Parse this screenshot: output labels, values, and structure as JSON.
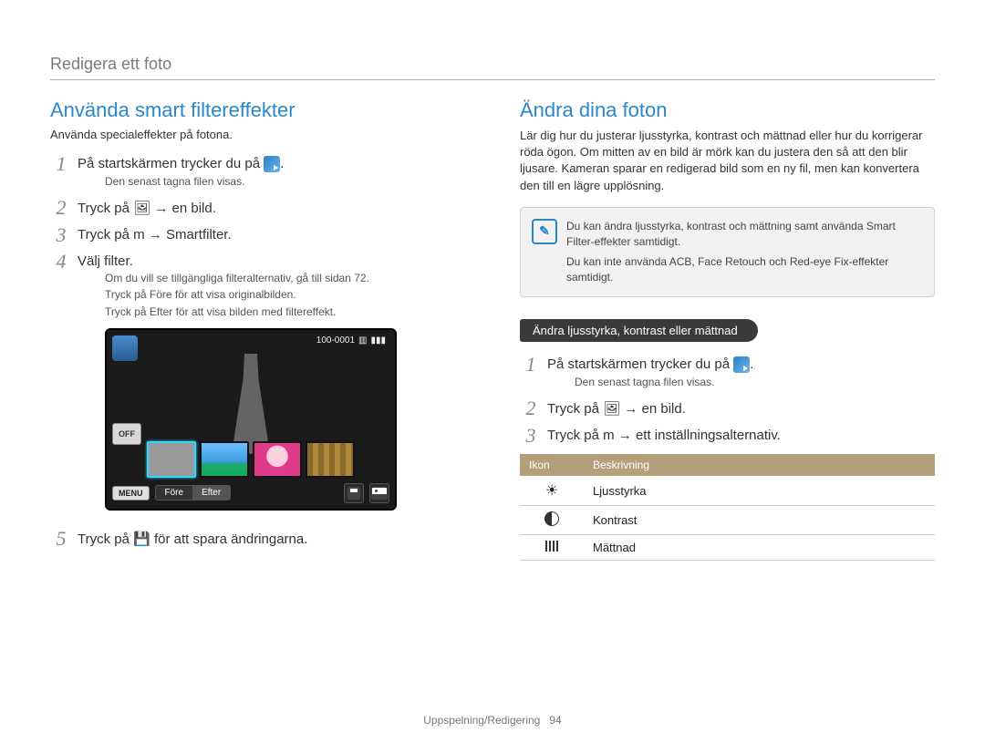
{
  "header": {
    "title": "Redigera ett foto"
  },
  "left": {
    "title": "Använda smart filtereffekter",
    "subtitle": "Använda specialeffekter på fotona.",
    "steps": [
      {
        "text_before": "På startskärmen trycker du på ",
        "note": "Den senast tagna filen visas."
      },
      {
        "text": "Tryck på 🖼 → en bild."
      },
      {
        "text": "Tryck på m → Smartfilter."
      },
      {
        "text": "Välj filter.",
        "notes": [
          "Om du vill se tillgängliga filteralternativ, gå till sidan 72.",
          "Tryck på Före för att visa originalbilden.",
          "Tryck på Efter för att visa bilden med filtereffekt."
        ]
      },
      {
        "text": "Tryck på 💾 för att spara ändringarna."
      }
    ],
    "camscreen": {
      "counter": "100-0001",
      "off": "OFF",
      "menu": "MENU",
      "before": "Före",
      "after": "Efter"
    }
  },
  "right": {
    "title": "Ändra dina foton",
    "intro": "Lär dig hur du justerar ljusstyrka, kontrast och mättnad eller hur du korrigerar röda ögon. Om mitten av en bild är mörk kan du justera den så att den blir ljusare. Kameran sparar en redigerad bild som en ny fil, men kan konvertera den till en lägre upplösning.",
    "info": [
      "Du kan ändra ljusstyrka, kontrast och mättning samt använda Smart Filter-effekter samtidigt.",
      "Du kan inte använda ACB, Face Retouch och Red-eye Fix-effekter samtidigt."
    ],
    "pill": "Ändra ljusstyrka, kontrast eller mättnad",
    "steps": [
      {
        "text_before": "På startskärmen trycker du på ",
        "note": "Den senast tagna filen visas."
      },
      {
        "text": "Tryck på 🖼 → en bild."
      },
      {
        "text": "Tryck på m → ett inställningsalternativ."
      }
    ],
    "table": {
      "head_icon": "Ikon",
      "head_desc": "Beskrivning",
      "rows": [
        {
          "desc": "Ljusstyrka"
        },
        {
          "desc": "Kontrast"
        },
        {
          "desc": "Mättnad"
        }
      ]
    }
  },
  "footer": {
    "section": "Uppspelning/Redigering",
    "page": "94"
  }
}
